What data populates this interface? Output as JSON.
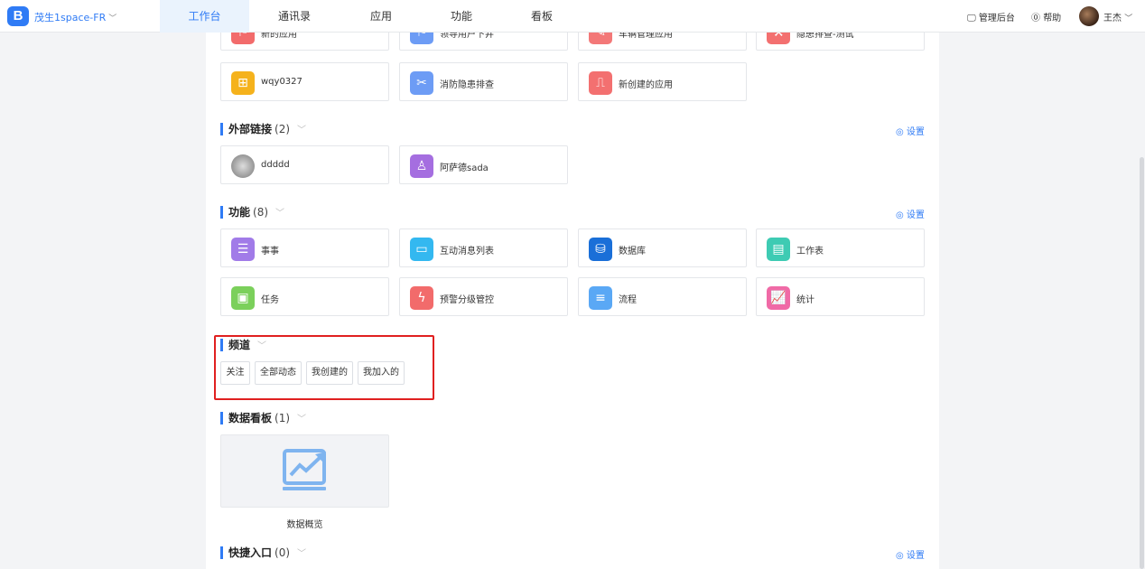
{
  "topbar": {
    "logo": "B",
    "org_name": "茂生1space-FR",
    "tabs": [
      "工作台",
      "通讯录",
      "应用",
      "功能",
      "看板"
    ],
    "admin_label": "管理后台",
    "help_label": "帮助",
    "user_name": "王杰"
  },
  "apps_row1": [
    "新的应用",
    "领导用户下井",
    "车辆管理应用",
    "隐患排查-测试"
  ],
  "apps_row2": [
    "wqy0327",
    "消防隐患排查",
    "新创建的应用"
  ],
  "external_links": {
    "title": "外部链接",
    "count": "(2)",
    "settings": "设置",
    "items": [
      "ddddd",
      "阿萨德sada"
    ]
  },
  "features": {
    "title": "功能",
    "count": "(8)",
    "settings": "设置",
    "items": [
      "事事",
      "互动消息列表",
      "数据库",
      "工作表",
      "任务",
      "预警分级管控",
      "流程",
      "统计"
    ]
  },
  "channels": {
    "title": "频道",
    "chips": [
      "关注",
      "全部动态",
      "我创建的",
      "我加入的"
    ]
  },
  "dashboards": {
    "title": "数据看板",
    "count": "(1)",
    "items": [
      "数据概览"
    ]
  },
  "shortcuts": {
    "title": "快捷入口",
    "count": "(0)",
    "settings": "设置"
  },
  "colors": {
    "accent": "#2f7bf5",
    "highlight_border": "#e02020"
  }
}
